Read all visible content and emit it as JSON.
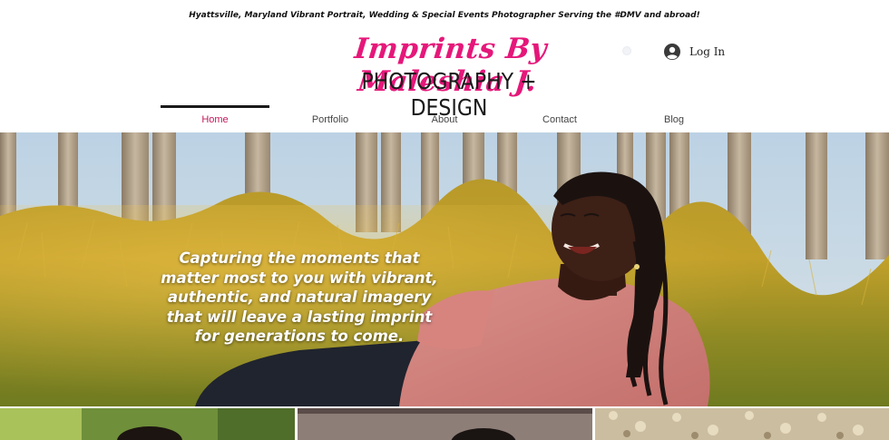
{
  "header": {
    "tagline": "Hyattsville, Maryland Vibrant Portrait, Wedding & Special Events Photographer Serving the #DMV and abroad!",
    "logo_script": "Imprints By Maleshia J.",
    "logo_subtitle": "PHOTOGRAPHY + DESIGN",
    "login_label": "Log In",
    "brand_color": "#e5187a"
  },
  "nav": {
    "items": [
      {
        "label": "Home",
        "active": true
      },
      {
        "label": "Portfolio",
        "active": false
      },
      {
        "label": "About",
        "active": false
      },
      {
        "label": "Contact",
        "active": false
      },
      {
        "label": "Blog",
        "active": false
      }
    ],
    "active_color": "#c2185b"
  },
  "hero": {
    "text": "Capturing the moments that matter most to you with vibrant, authentic, and natural imagery that will leave a lasting imprint for generations to come."
  },
  "icons": {
    "login": "user-avatar-icon"
  }
}
